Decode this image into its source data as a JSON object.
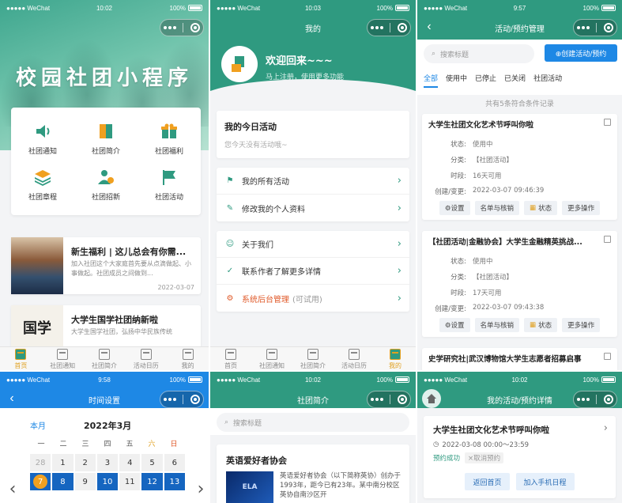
{
  "status": {
    "carrier": "●●●●● WeChat",
    "battery": "100%",
    "times": [
      "10:02",
      "10:03",
      "9:57",
      "9:58",
      "10:02",
      "10:02"
    ]
  },
  "screen_home": {
    "hero_title": "校园社团小程序",
    "grid": [
      {
        "label": "社团通知",
        "icon": "speaker-icon"
      },
      {
        "label": "社团简介",
        "icon": "book-icon"
      },
      {
        "label": "社团福利",
        "icon": "gift-icon"
      },
      {
        "label": "社团章程",
        "icon": "layers-icon"
      },
      {
        "label": "社团招新",
        "icon": "person-add-icon"
      },
      {
        "label": "社团活动",
        "icon": "flag-icon"
      }
    ],
    "news": [
      {
        "title": "新生福利 | 这儿总会有你需...",
        "desc": "加入社团这个大家庭首先要从点滴做起、小事做起。社团成员之间做到...",
        "date": "2022-03-07"
      },
      {
        "title": "大学生国学社团纳新啦",
        "desc": "大学生国学社团，弘扬中华民族传统",
        "date": ""
      }
    ],
    "thumb2_text": "国学"
  },
  "tabbar": [
    "首页",
    "社团通知",
    "社团简介",
    "活动日历",
    "我的"
  ],
  "screen_mine": {
    "title": "我的",
    "welcome": "欢迎回来~~~",
    "register": "马上注册，使用更多功能",
    "today_title": "我的今日活动",
    "today_empty": "您今天没有活动哦~",
    "menu_group1": [
      {
        "label": "我的所有活动",
        "icon": "flag-icon"
      },
      {
        "label": "修改我的个人资料",
        "icon": "edit-icon"
      }
    ],
    "menu_group2": [
      {
        "label": "关于我们",
        "icon": "people-icon"
      },
      {
        "label": "联系作者了解更多详情",
        "icon": "check-circle-icon"
      },
      {
        "label": "系统后台管理",
        "extra": "(可试用)",
        "icon": "gear-icon"
      }
    ]
  },
  "screen_manage": {
    "title": "活动/预约管理",
    "search_placeholder": "搜索标题",
    "create": "⊕创建活动/预约",
    "filters": [
      "全部",
      "使用中",
      "已停止",
      "已关闭",
      "社团活动"
    ],
    "count": "共有5条符合条件记录",
    "cards": [
      {
        "title": "大学生社团文化艺术节呼叫你啦",
        "rows": [
          {
            "k": "状态:",
            "v": "使用中"
          },
          {
            "k": "分类:",
            "v": "【社团活动】"
          },
          {
            "k": "时段:",
            "v": "16天可用"
          },
          {
            "k": "创建/变更:",
            "v": "2022-03-07 09:46:39"
          }
        ],
        "buttons": [
          "⚙设置",
          "名单与核销",
          "状态",
          "更多操作"
        ]
      },
      {
        "title": "【社团活动|金融协会】大学生金融精英挑战...",
        "rows": [
          {
            "k": "状态:",
            "v": "使用中"
          },
          {
            "k": "分类:",
            "v": "【社团活动】"
          },
          {
            "k": "时段:",
            "v": "17天可用"
          },
          {
            "k": "创建/变更:",
            "v": "2022-03-07 09:43:38"
          }
        ],
        "buttons": [
          "⚙设置",
          "名单与核销",
          "状态",
          "更多操作"
        ]
      },
      {
        "title": "史学研究社|武汉博物馆大学生志愿者招募启事",
        "rows": [],
        "buttons": []
      }
    ]
  },
  "screen_calendar": {
    "title": "时间设置",
    "month_label": "本月",
    "month_value": "2022年3月",
    "weekdays": [
      "一",
      "二",
      "三",
      "四",
      "五",
      "六",
      "日"
    ],
    "days_row1": [
      "28",
      "1",
      "2",
      "3",
      "4",
      "5",
      "6"
    ],
    "days_row2": [
      "7",
      "8",
      "9",
      "10",
      "11",
      "12",
      "13"
    ],
    "today": "7"
  },
  "screen_intro": {
    "title": "社团简介",
    "search_placeholder": "搜索标题",
    "club_title": "英语爱好者协会",
    "club_img_text": "ELA",
    "club_desc": "英语爱好者协会（以下简称英协）创办于1993年，距今已有23年。某中南分校区英协自南沙区开"
  },
  "screen_detail": {
    "title": "我的活动/预约详情",
    "activity_title": "大学生社团文化艺术节呼叫你啦",
    "time": "2022-03-08 00:00～23:59",
    "status": "预约成功",
    "cancel": "×取消预约",
    "btn_home": "返回首页",
    "btn_calendar": "加入手机日程"
  }
}
